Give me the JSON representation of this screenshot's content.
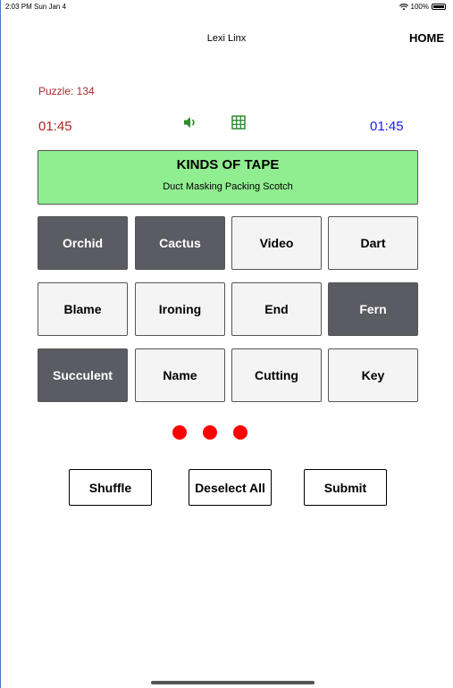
{
  "status_bar": {
    "time": "2:03 PM  Sun Jan 4",
    "battery": "100%"
  },
  "header": {
    "title": "Lexi Linx",
    "home_label": "HOME"
  },
  "puzzle": {
    "label": "Puzzle: 134"
  },
  "timers": {
    "left": "01:45",
    "right": "01:45"
  },
  "icons": {
    "sound": "speaker-icon",
    "grid": "grid-icon"
  },
  "solved_group": {
    "title": "KINDS OF TAPE",
    "words": "Duct  Masking  Packing  Scotch",
    "color": "#90ee90"
  },
  "tiles": [
    {
      "label": "Orchid",
      "selected": true
    },
    {
      "label": "Cactus",
      "selected": true
    },
    {
      "label": "Video",
      "selected": false
    },
    {
      "label": "Dart",
      "selected": false
    },
    {
      "label": "Blame",
      "selected": false
    },
    {
      "label": "Ironing",
      "selected": false
    },
    {
      "label": "End",
      "selected": false
    },
    {
      "label": "Fern",
      "selected": true
    },
    {
      "label": "Succulent",
      "selected": true
    },
    {
      "label": "Name",
      "selected": false
    },
    {
      "label": "Cutting",
      "selected": false
    },
    {
      "label": "Key",
      "selected": false
    }
  ],
  "mistakes_remaining": 3,
  "buttons": {
    "shuffle": "Shuffle",
    "deselect_all": "Deselect All",
    "submit": "Submit"
  },
  "colors": {
    "selected_tile": "#5b5b63",
    "unselected_tile": "#f4f4f4",
    "timer_left": "#b22222",
    "timer_right": "#1a1aff",
    "mistake_dot": "#ff0000"
  }
}
